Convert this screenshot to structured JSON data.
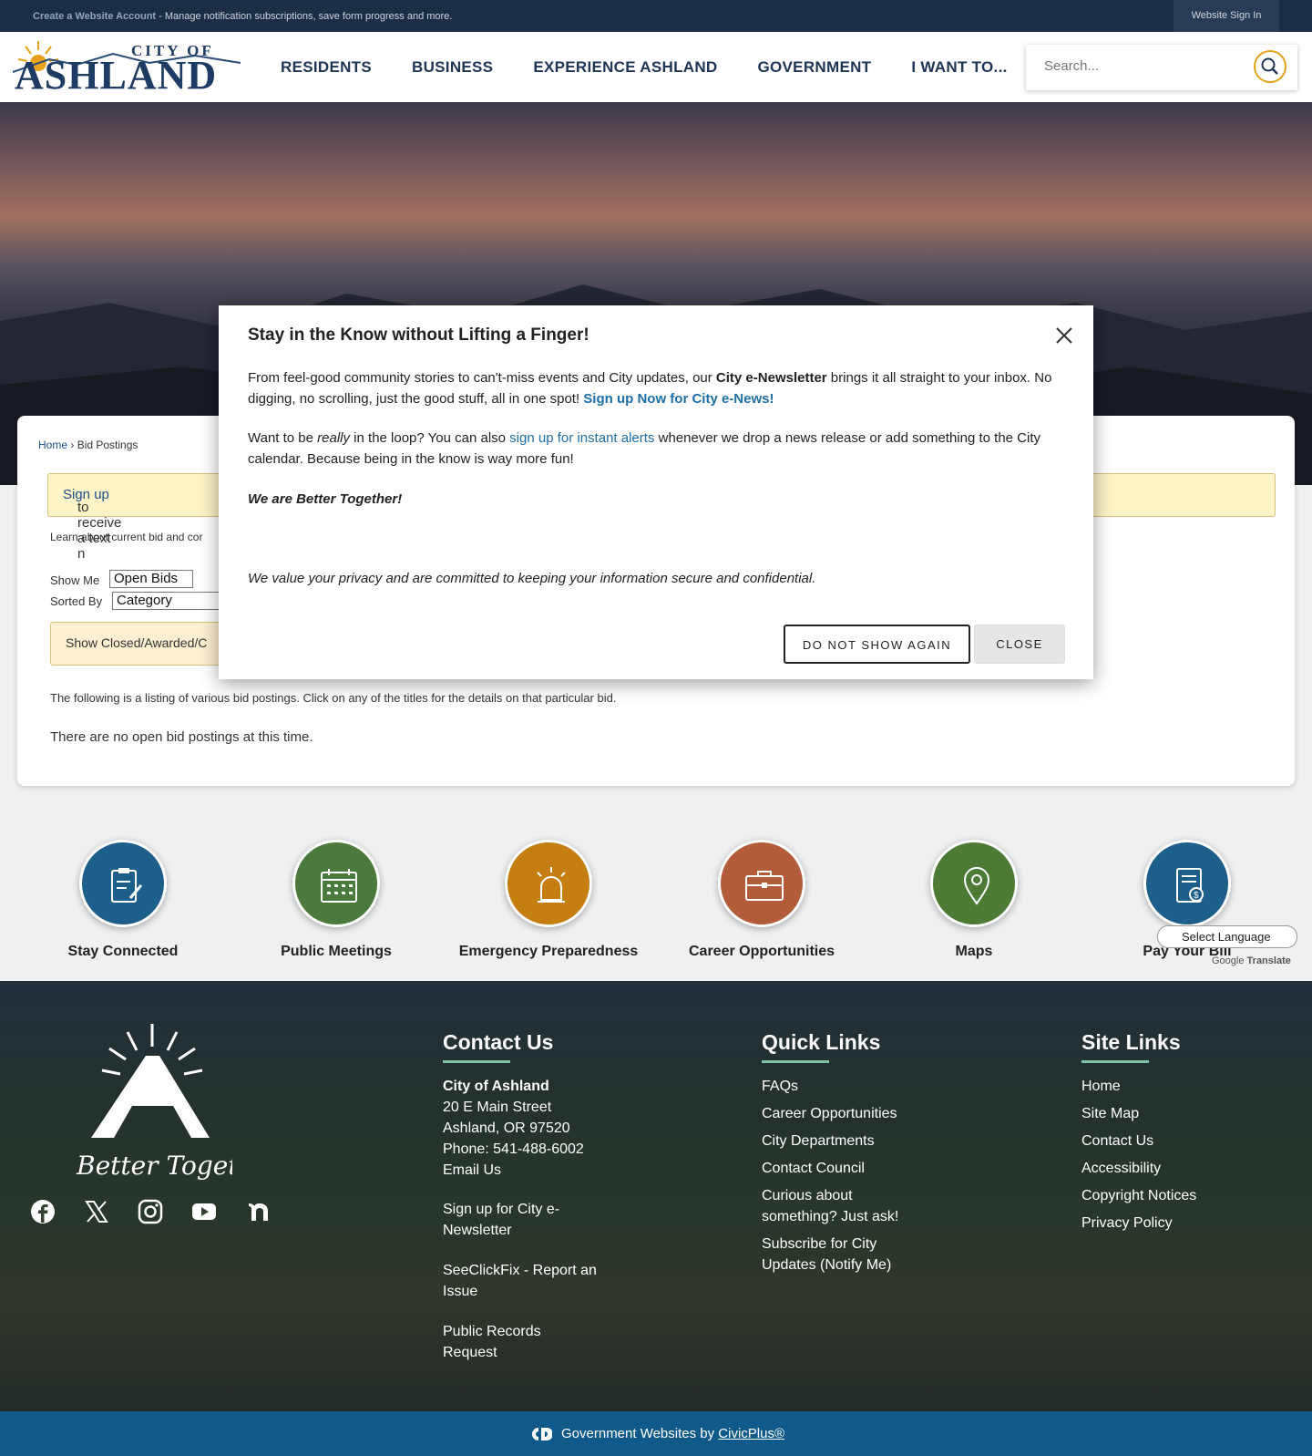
{
  "topbar": {
    "create_account": "Create a Website Account",
    "create_account_desc": " - Manage notification subscriptions, save form progress and more.",
    "sign_in": "Website Sign In"
  },
  "header": {
    "logo_text_top": "CITY OF",
    "logo_text_main": "ASHLAND",
    "nav": [
      "RESIDENTS",
      "BUSINESS",
      "EXPERIENCE ASHLAND",
      "GOVERNMENT",
      "I WANT TO..."
    ],
    "search_placeholder": "Search..."
  },
  "breadcrumb": {
    "home": "Home",
    "sep": " › ",
    "current": "Bid Postings"
  },
  "content": {
    "signup_link": "Sign up",
    "signup_text": " to receive a text n",
    "learn_text": "Learn about current bid and cor",
    "show_me_label": "Show Me",
    "show_me_value": "Open Bids",
    "sorted_by_label": "Sorted By",
    "sorted_by_value": "Category",
    "closed_bar": "Show Closed/Awarded/C",
    "listing_text": "The following is a listing of various bid postings. Click on any of the titles for the details on that particular bid.",
    "no_bids": "There are no open bid postings at this time."
  },
  "quick_icons": [
    {
      "label": "Stay Connected",
      "color": "#1e5e8a",
      "icon": "clipboard-icon"
    },
    {
      "label": "Public Meetings",
      "color": "#4b7a3c",
      "icon": "calendar-icon"
    },
    {
      "label": "Emergency Preparedness",
      "color": "#c47e12",
      "icon": "siren-icon"
    },
    {
      "label": "Career Opportunities",
      "color": "#b35c3a",
      "icon": "briefcase-icon"
    },
    {
      "label": "Maps",
      "color": "#4d7a34",
      "icon": "map-pin-icon"
    },
    {
      "label": "Pay Your Bill",
      "color": "#1e5e8a",
      "icon": "bill-icon"
    }
  ],
  "translate": {
    "select": "Select Language",
    "powered_google": "Google",
    "powered_translate": "Translate"
  },
  "footer": {
    "tagline": "Better Together",
    "contact": {
      "title": "Contact Us",
      "org": "City of Ashland",
      "street": "20 E Main Street",
      "city": "Ashland, OR 97520",
      "phone": "Phone: 541-488-6002",
      "email": "Email Us",
      "newsletter_1": "Sign up for City e-",
      "newsletter_2": "Newsletter",
      "seeclick_1": "SeeClickFix - Report an",
      "seeclick_2": "Issue",
      "records_1": "Public Records",
      "records_2": "Request"
    },
    "quick_links": {
      "title": "Quick Links",
      "items": [
        "FAQs",
        "Career Opportunities",
        "City Departments",
        "Contact Council",
        "Curious about",
        "something? Just ask!",
        "Subscribe for City",
        "Updates (Notify Me)"
      ]
    },
    "site_links": {
      "title": "Site Links",
      "items": [
        "Home",
        "Site Map",
        "Contact Us",
        "Accessibility",
        "Copyright Notices",
        "Privacy Policy"
      ]
    },
    "bottom_prefix": "Government Websites by ",
    "bottom_link": "CivicPlus®"
  },
  "modal": {
    "title": "Stay in the Know without Lifting a Finger!",
    "p1_a": "From feel-good community stories to can't-miss events and City updates, our ",
    "p1_b": "City e-Newsletter",
    "p1_c": " brings it all straight to your inbox. No digging, no scrolling, just the good stuff, all in one spot! ",
    "p1_link": "Sign up Now for City e-News!",
    "p2_a": "Want to be ",
    "p2_b": "really",
    "p2_c": " in the loop? You can also ",
    "p2_link": "sign up for instant alerts",
    "p2_d": " whenever we drop a news release or add something to the City calendar. Because being in the know is way more fun!",
    "p3": "We are Better Together!",
    "p4": "We value your privacy and are committed to keeping your information secure and confidential.",
    "btn_dns": "DO NOT SHOW AGAIN",
    "btn_close": "CLOSE"
  }
}
